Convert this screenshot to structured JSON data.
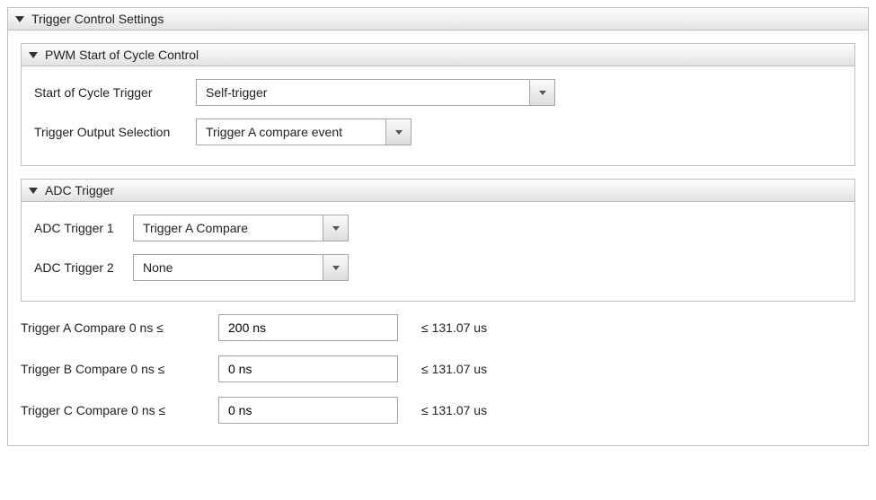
{
  "main": {
    "title": "Trigger Control Settings",
    "pwm_section": {
      "title": "PWM Start of Cycle Control",
      "start_trigger_label": "Start of Cycle Trigger",
      "start_trigger_value": "Self-trigger",
      "output_sel_label": "Trigger Output Selection",
      "output_sel_value": "Trigger A compare event"
    },
    "adc_section": {
      "title": "ADC Trigger",
      "adc1_label": "ADC Trigger 1",
      "adc1_value": "Trigger A Compare",
      "adc2_label": "ADC Trigger 2",
      "adc2_value": "None"
    },
    "compares": [
      {
        "label": "Trigger A Compare  0 ns  ≤",
        "value": "200 ns",
        "upper": "≤  131.07 us"
      },
      {
        "label": "Trigger B Compare  0 ns  ≤",
        "value": "0 ns",
        "upper": "≤  131.07 us"
      },
      {
        "label": "Trigger C Compare  0 ns  ≤",
        "value": "0 ns",
        "upper": "≤  131.07 us"
      }
    ]
  }
}
